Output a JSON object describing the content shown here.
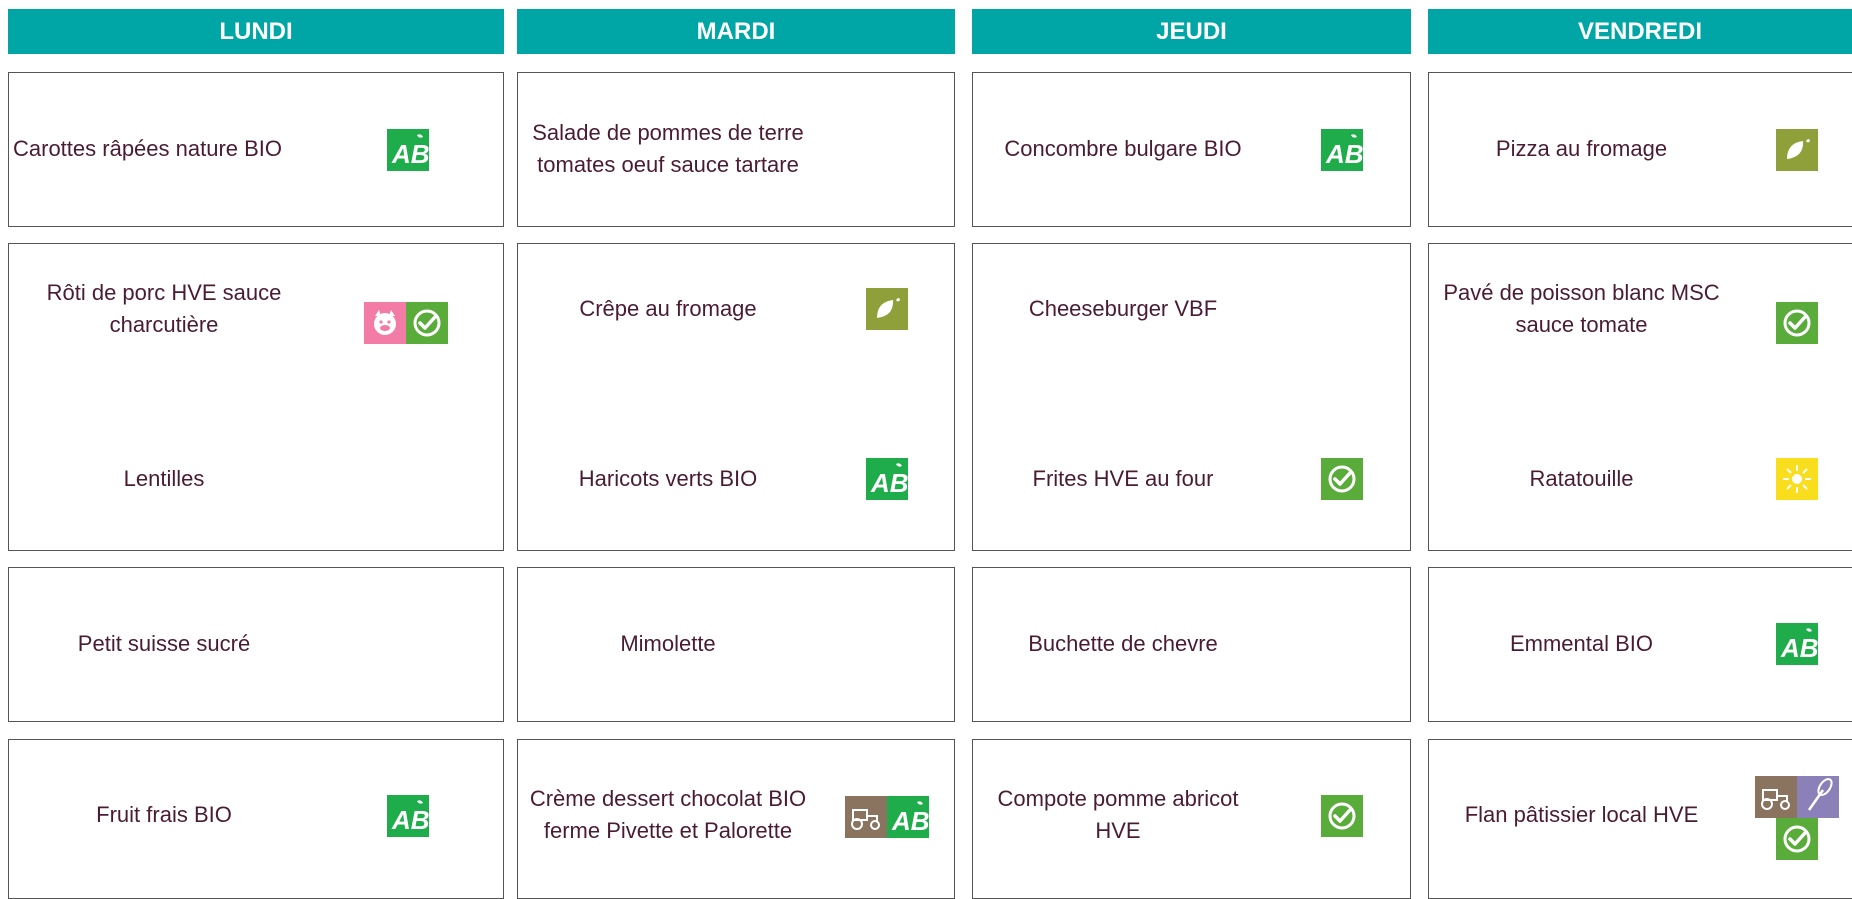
{
  "days": [
    {
      "name": "LUNDI",
      "entree": {
        "text": "Carottes râpées nature BIO",
        "icons": [
          "ab-bio-icon"
        ]
      },
      "plat": {
        "text": "Rôti de porc HVE sauce charcutière",
        "icons": [
          "pork-icon",
          "hve-check-icon"
        ]
      },
      "garniture": {
        "text": "Lentilles",
        "icons": []
      },
      "laitage": {
        "text": "Petit suisse sucré",
        "icons": []
      },
      "dessert": {
        "text": "Fruit frais BIO",
        "icons": [
          "ab-bio-icon"
        ]
      }
    },
    {
      "name": "MARDI",
      "entree": {
        "text": "Salade de pommes de terre tomates oeuf sauce tartare",
        "icons": []
      },
      "plat": {
        "text": "Crêpe au fromage",
        "icons": [
          "vegetarian-leaf-icon"
        ]
      },
      "garniture": {
        "text": "Haricots verts BIO",
        "icons": [
          "ab-bio-icon"
        ]
      },
      "laitage": {
        "text": "Mimolette",
        "icons": []
      },
      "dessert": {
        "text": "Crème dessert chocolat BIO ferme Pivette et Palorette",
        "icons": [
          "local-farm-tractor-icon",
          "ab-bio-icon"
        ]
      }
    },
    {
      "name": "JEUDI",
      "entree": {
        "text": "Concombre bulgare BIO",
        "icons": [
          "ab-bio-icon"
        ]
      },
      "plat": {
        "text": "Cheeseburger VBF",
        "icons": []
      },
      "garniture": {
        "text": "Frites HVE au four",
        "icons": [
          "hve-check-icon"
        ]
      },
      "laitage": {
        "text": "Buchette de chevre",
        "icons": []
      },
      "dessert": {
        "text": "Compote pomme abricot HVE",
        "icons": [
          "hve-check-icon"
        ]
      }
    },
    {
      "name": "VENDREDI",
      "entree": {
        "text": "Pizza au fromage",
        "icons": [
          "vegetarian-leaf-icon"
        ]
      },
      "plat": {
        "text": "Pavé de poisson blanc MSC sauce tomate",
        "icons": [
          "hve-check-icon"
        ]
      },
      "garniture": {
        "text": "Ratatouille",
        "icons": [
          "sun-seasonal-icon"
        ]
      },
      "laitage": {
        "text": "Emmental BIO",
        "icons": [
          "ab-bio-icon"
        ]
      },
      "dessert": {
        "text": "Flan pâtissier local HVE",
        "icons": [
          "local-farm-tractor-icon",
          "homemade-whisk-icon",
          "hve-check-icon"
        ]
      }
    }
  ],
  "colors": {
    "header": "#00a5a5",
    "text": "#4a1c34",
    "ab_green": "#1fac4b",
    "hve_green": "#5aac3a",
    "veg_olive": "#8fa03a",
    "pork_pink": "#f27ca6",
    "sun_yellow": "#f8de1c",
    "farm_brown": "#8a7460",
    "patis_purple": "#8b80b8"
  }
}
